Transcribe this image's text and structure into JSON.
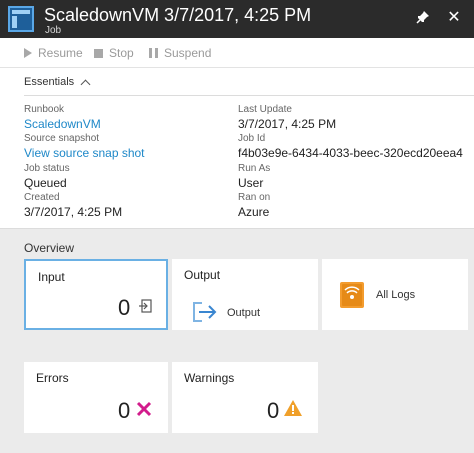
{
  "header": {
    "title": "ScaledownVM 3/7/2017, 4:25 PM",
    "subtitle": "Job",
    "pin_glyph": "📌",
    "close_glyph": "✕"
  },
  "toolbar": {
    "resume_label": "Resume",
    "stop_label": "Stop",
    "suspend_label": "Suspend"
  },
  "essentials": {
    "label": "Essentials",
    "left": [
      {
        "label": "Runbook",
        "value": "ScaledownVM",
        "link": true
      },
      {
        "label": "Source snapshot",
        "value": "View source snap shot",
        "link": true
      },
      {
        "label": "Job status",
        "value": "Queued",
        "link": false
      },
      {
        "label": "Created",
        "value": "3/7/2017, 4:25 PM",
        "link": false
      }
    ],
    "right": [
      {
        "label": "Last Update",
        "value": "3/7/2017, 4:25 PM"
      },
      {
        "label": "Job Id",
        "value": "f4b03e9e-6434-4033-beec-320ecd20eea4"
      },
      {
        "label": "Run As",
        "value": "User"
      },
      {
        "label": "Ran on",
        "value": "Azure"
      }
    ]
  },
  "overview": {
    "title": "Overview",
    "input": {
      "label": "Input",
      "count": "0"
    },
    "output": {
      "label": "Output",
      "sub_label": "Output"
    },
    "logs": {
      "label": "All Logs"
    },
    "errors": {
      "label": "Errors",
      "count": "0"
    },
    "warnings": {
      "label": "Warnings",
      "count": "0"
    }
  },
  "colors": {
    "header_bg": "#2b2b2b",
    "link": "#1e88c8",
    "error": "#d21c8c",
    "warning": "#f0a02a",
    "logs": "#f39c2e",
    "selected_border": "#6ab0e4"
  }
}
